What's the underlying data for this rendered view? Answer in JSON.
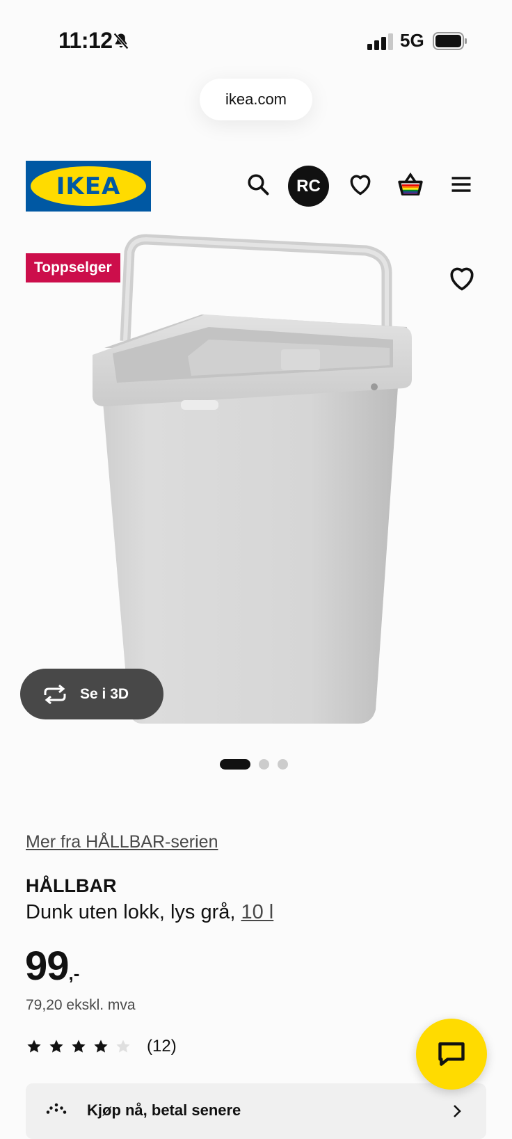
{
  "status_bar": {
    "time": "11:12",
    "network": "5G"
  },
  "browser": {
    "url": "ikea.com"
  },
  "header": {
    "logo_text": "IKEA",
    "avatar_initials": "RC",
    "icons": [
      "search-icon",
      "heart-icon",
      "shopping-bag-icon",
      "hamburger-menu-icon"
    ]
  },
  "product_image": {
    "badge": "Toppselger",
    "see_3d_label": "Se i 3D",
    "carousel": {
      "count": 3,
      "active_index": 0
    }
  },
  "product": {
    "series_link": "Mer fra HÅLLBAR-serien",
    "name": "HÅLLBAR",
    "description": "Dunk uten lokk, lys grå, ",
    "size_link": "10 l",
    "price_main": "99",
    "price_suffix": ",-",
    "price_excl_vat": "79,20 ekskl. mva",
    "rating": {
      "stars": 4,
      "max": 5,
      "count_label": "(12)"
    }
  },
  "klarna_banner": {
    "label": "Kjøp nå, betal senere"
  },
  "colors": {
    "ikea_blue": "#0058a3",
    "ikea_yellow": "#ffdb00",
    "badge_red": "#cc0e4b",
    "see3d_bg": "#484848"
  }
}
